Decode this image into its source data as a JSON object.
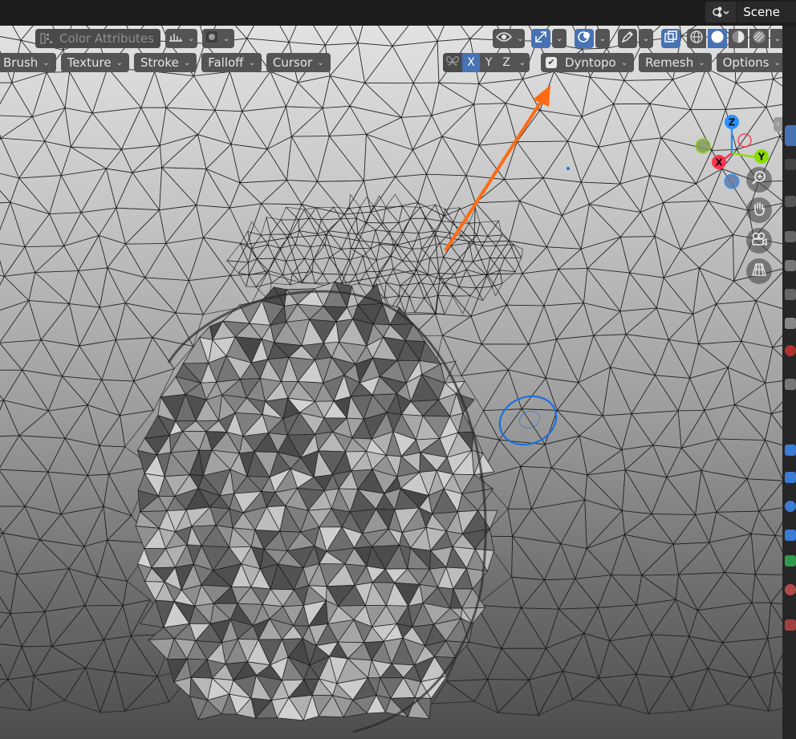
{
  "topbar": {
    "scene_label": "Scene",
    "scene_icon": "scene-icon"
  },
  "header_row1": {
    "color_attributes_label": "Color Attributes",
    "icons": [
      "color-attributes-icon",
      "falloff-curve-icon",
      "shading-dot-icon",
      "visibility-eye-icon",
      "gizmo-icon",
      "overlay-icon",
      "pen-icon",
      "xray-icon",
      "wireframe-shading-icon",
      "solid-shading-icon",
      "material-shading-icon",
      "rendered-shading-icon"
    ]
  },
  "header_row2": {
    "brush_label": "Brush",
    "texture_label": "Texture",
    "stroke_label": "Stroke",
    "falloff_label": "Falloff",
    "cursor_label": "Cursor",
    "symmetry_x": "X",
    "symmetry_y": "Y",
    "symmetry_z": "Z",
    "dyntopo_label": "Dyntopo",
    "dyntopo_checked": true,
    "remesh_label": "Remesh",
    "options_label": "Options"
  },
  "gizmo": {
    "z_label": "Z",
    "y_label": "Y",
    "x_label": "X",
    "x_color": "#ff3352",
    "y_color": "#8bdc00",
    "z_color": "#2890ff"
  },
  "nav_icons": [
    "zoom-icon",
    "pan-hand-icon",
    "camera-icon",
    "grid-perspective-icon"
  ],
  "annotation": {
    "arrow_color": "#ff6a13",
    "brush_cursor_color": "#1a6fe0"
  }
}
